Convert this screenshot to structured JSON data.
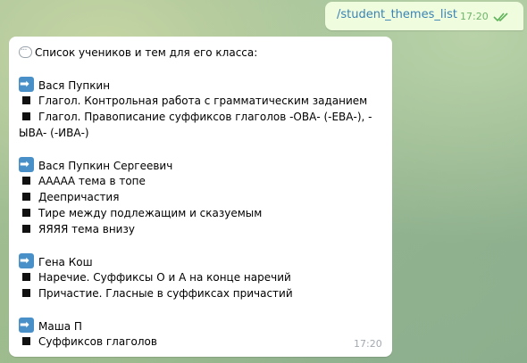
{
  "outgoing": {
    "text": "/student_themes_list",
    "time": "17:20",
    "status_icon": "double-check-icon"
  },
  "incoming": {
    "header_icon": "speech-bubble-icon",
    "header": "Список учеников и тем для его класса:",
    "students": [
      {
        "name": "Вася Пупкин",
        "themes": [
          "Глагол. Контрольная работа с грамматическим заданием",
          "Глагол. Правописание суффиксов глаголов -ОВА- (-ЕВА-), -",
          "ЫВА- (-ИВА-)"
        ]
      },
      {
        "name": "Вася Пупкин Сергеевич",
        "themes": [
          "ААААА тема в топе",
          "Деепричастия",
          "Тире между подлежащим и сказуемым",
          "ЯЯЯЯ тема внизу"
        ]
      },
      {
        "name": "Гена Кош",
        "themes": [
          "Наречие. Суффиксы О и А на конце наречий",
          "Причастие. Гласные в суффиксах причастий"
        ]
      },
      {
        "name": "Маша П",
        "themes": [
          "Суффиксов глаголов"
        ]
      }
    ],
    "time": "17:20"
  },
  "colors": {
    "outgoing_bubble": "#effdde",
    "command_link": "#3a82b4",
    "outgoing_time": "#6fb36a",
    "incoming_bubble": "#ffffff",
    "arrow_icon": "#4a90c8"
  }
}
